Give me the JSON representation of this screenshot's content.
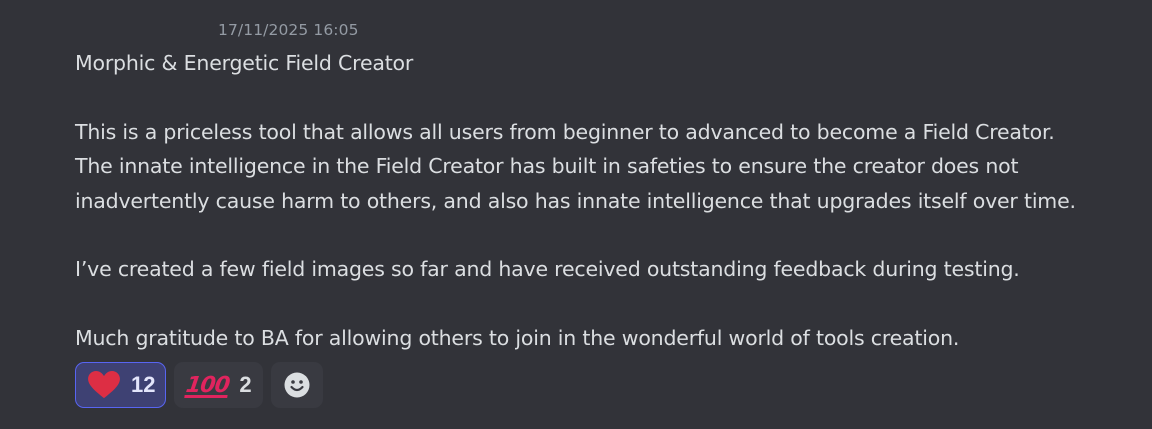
{
  "message": {
    "timestamp": "17/11/2025 16:05",
    "lines": [
      "Morphic & Energetic Field Creator",
      "",
      "This is a priceless tool that allows all users from beginner to advanced to become a Field Creator.",
      "The innate intelligence in the Field Creator has built in safeties to ensure the creator does not",
      "inadvertently cause harm to others, and also has innate intelligence that upgrades itself over time.",
      "",
      "I’ve created a few field images so far and have received outstanding feedback during testing.",
      "",
      "Much gratitude to BA for allowing others to join in the wonderful world of tools creation."
    ]
  },
  "reactions": [
    {
      "emoji": "heart-icon",
      "count": "12",
      "active": true,
      "color": "#dd2e44"
    },
    {
      "emoji": "hundred-points-icon",
      "glyph": "100",
      "count": "2",
      "active": false,
      "color": "#e0245e"
    }
  ],
  "add_reaction": {
    "icon": "smiley-add-reaction-icon"
  },
  "colors": {
    "background": "#323339",
    "text": "#dbdee1",
    "timestamp": "#949ba4",
    "reaction_bg": "#393a41",
    "reaction_active_bg": "#3e4173",
    "reaction_active_border": "#5865f2"
  }
}
